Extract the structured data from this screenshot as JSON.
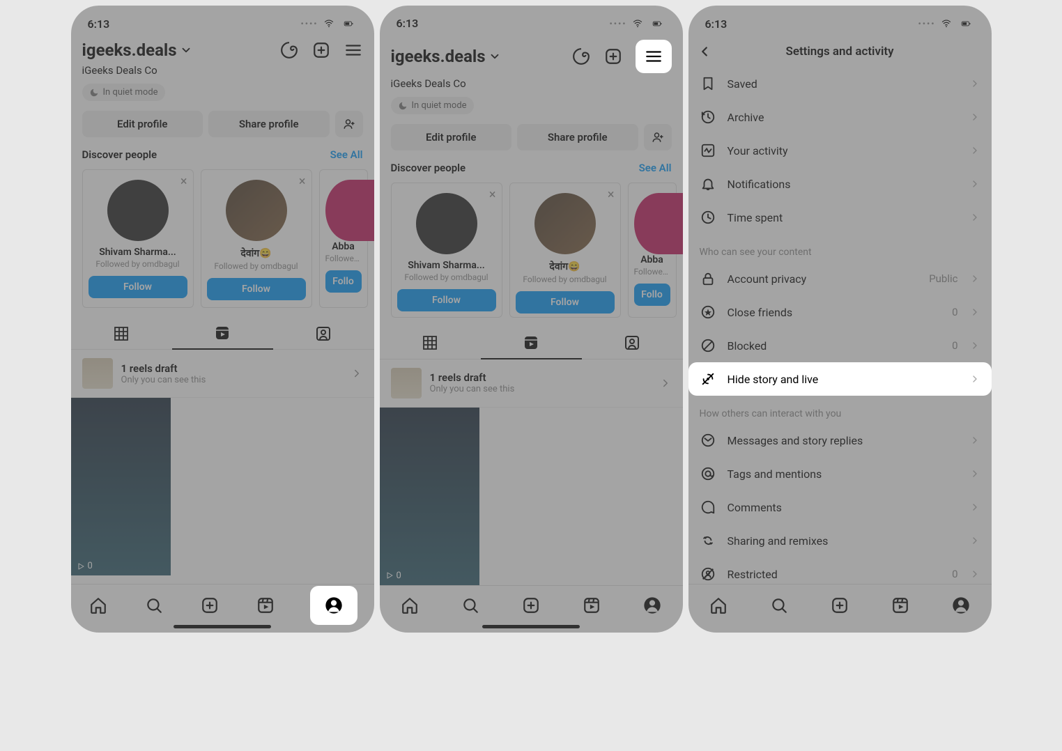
{
  "status": {
    "time": "6:13"
  },
  "profile": {
    "username": "igeeks.deals",
    "display_name": "iGeeks Deals Co",
    "quiet_mode": "In quiet mode",
    "edit_button": "Edit profile",
    "share_button": "Share profile"
  },
  "discover": {
    "title": "Discover people",
    "see_all": "See All",
    "people": [
      {
        "name": "Shivam Sharma...",
        "sub": "Followed by omdbagul",
        "follow": "Follow"
      },
      {
        "name": "देवांग😄",
        "sub": "Followed by omdbagul",
        "follow": "Follow"
      },
      {
        "name": "Abba",
        "sub": "Followed by omdba",
        "follow": "Follo"
      }
    ]
  },
  "draft": {
    "title": "1 reels draft",
    "subtitle": "Only you can see this"
  },
  "reel": {
    "count": "0"
  },
  "settings": {
    "title": "Settings and activity",
    "items_top": [
      {
        "icon": "bookmark",
        "label": "Saved"
      },
      {
        "icon": "archive",
        "label": "Archive"
      },
      {
        "icon": "activity",
        "label": "Your activity"
      },
      {
        "icon": "bell",
        "label": "Notifications"
      },
      {
        "icon": "clock",
        "label": "Time spent"
      }
    ],
    "section_privacy": "Who can see your content",
    "items_privacy": [
      {
        "icon": "lock",
        "label": "Account privacy",
        "value": "Public"
      },
      {
        "icon": "star",
        "label": "Close friends",
        "value": "0"
      },
      {
        "icon": "block",
        "label": "Blocked",
        "value": "0"
      },
      {
        "icon": "hide",
        "label": "Hide story and live",
        "highlight": true
      }
    ],
    "section_interact": "How others can interact with you",
    "items_interact": [
      {
        "icon": "message",
        "label": "Messages and story replies"
      },
      {
        "icon": "at",
        "label": "Tags and mentions"
      },
      {
        "icon": "comment",
        "label": "Comments"
      },
      {
        "icon": "share",
        "label": "Sharing and remixes"
      },
      {
        "icon": "restrict",
        "label": "Restricted",
        "value": "0"
      }
    ]
  }
}
